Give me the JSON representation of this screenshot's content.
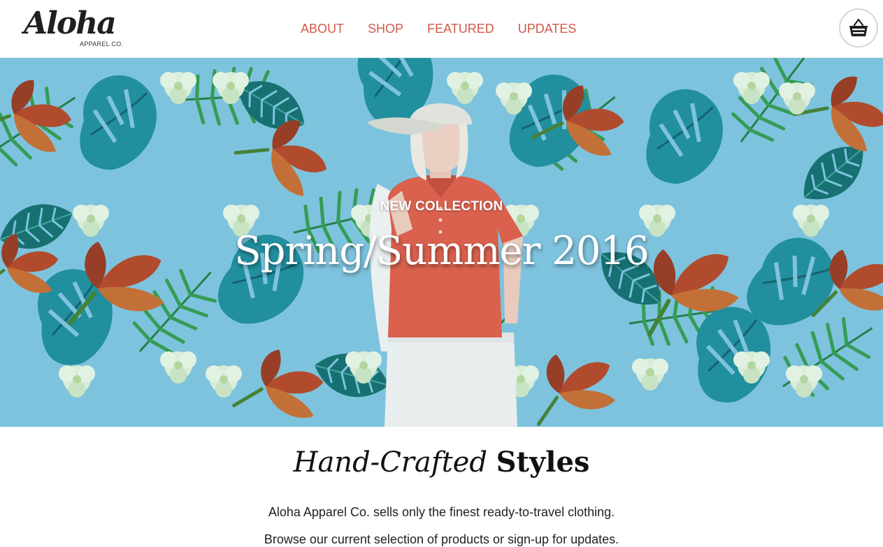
{
  "brand": {
    "logo_script": "Aloha",
    "logo_sub": "APPAREL CO."
  },
  "nav": {
    "items": [
      {
        "label": "ABOUT"
      },
      {
        "label": "SHOP"
      },
      {
        "label": "FEATURED"
      },
      {
        "label": "UPDATES"
      }
    ],
    "color": "#d3584a"
  },
  "cart": {
    "icon": "basket-icon"
  },
  "hero": {
    "kicker": "NEW COLLECTION",
    "title": "Spring/Summer 2016",
    "background_color": "#7ec4df",
    "pattern": "tropical-leaves-and-flowers"
  },
  "intro": {
    "heading_em": "Hand-Crafted",
    "heading_strong": "Styles",
    "paragraph_1": "Aloha Apparel Co. sells only the finest ready-to-travel clothing.",
    "paragraph_2": "Browse our current selection of products or sign-up for updates."
  }
}
